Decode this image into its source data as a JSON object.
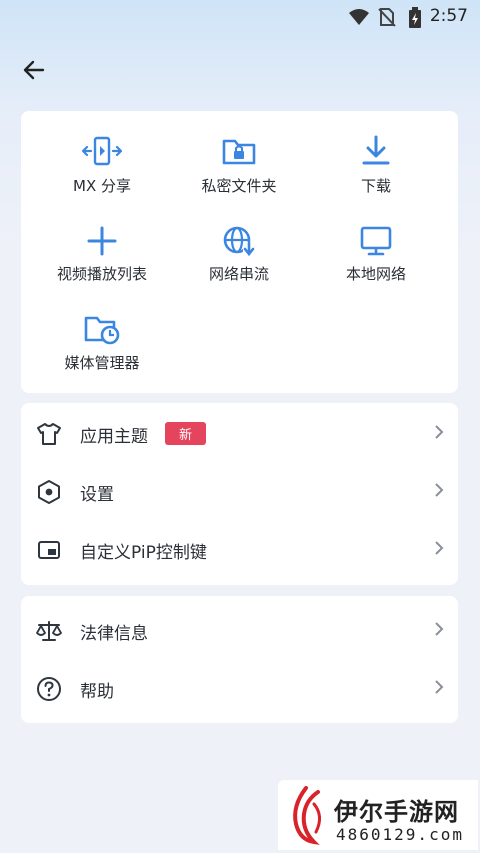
{
  "status_bar": {
    "time": "2:57"
  },
  "colors": {
    "accent": "#3b86e0",
    "badge": "#e5455c",
    "background": "#eef1f7"
  },
  "grid": [
    {
      "label": "MX 分享",
      "icon": "share-transfer-icon"
    },
    {
      "label": "私密文件夹",
      "icon": "locked-folder-icon"
    },
    {
      "label": "下载",
      "icon": "download-icon"
    },
    {
      "label": "视频播放列表",
      "icon": "plus-icon"
    },
    {
      "label": "网络串流",
      "icon": "globe-stream-icon"
    },
    {
      "label": "本地网络",
      "icon": "monitor-icon"
    },
    {
      "label": "媒体管理器",
      "icon": "folder-clock-icon"
    }
  ],
  "settings": [
    {
      "label": "应用主题",
      "badge": "新",
      "icon": "tshirt-icon"
    },
    {
      "label": "设置",
      "icon": "hexagon-gear-icon"
    },
    {
      "label": "自定义PiP控制键",
      "icon": "pip-icon"
    }
  ],
  "legal": [
    {
      "label": "法律信息",
      "icon": "scale-icon"
    },
    {
      "label": "帮助",
      "icon": "help-circle-icon"
    }
  ],
  "watermark": {
    "text": "伊尔手游网",
    "number": "4860129.com"
  }
}
